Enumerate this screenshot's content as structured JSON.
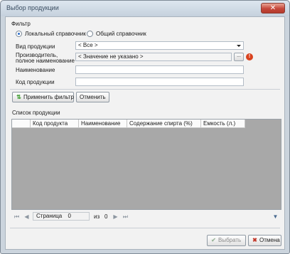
{
  "window": {
    "title": "Выбор продукции",
    "close_glyph": "✕"
  },
  "filter": {
    "group_title": "Фильтр",
    "radio_local": "Локальный справочник",
    "radio_common": "Общий справочник",
    "product_type_label": "Вид продукции",
    "product_type_value": "< Все >",
    "producer_label_line1": "Производитель,",
    "producer_label_line2": "полное наименование",
    "producer_value": "< Значение не указано >",
    "browse_label": "...",
    "info_glyph": "!",
    "name_label": "Наименование",
    "name_value": "",
    "code_label": "Код продукции",
    "code_value": "",
    "apply_button": "Применить фильтр",
    "reset_button": "Отменить"
  },
  "list": {
    "title": "Список продукции",
    "columns": [
      "Код продукта",
      "Наименование",
      "Содержание спирта (%)",
      "Емкость (л.)"
    ],
    "rows": []
  },
  "pager": {
    "page_label": "Страница",
    "page_value": "0",
    "of_label": "из",
    "total_value": "0"
  },
  "footer": {
    "select_button": "Выбрать",
    "cancel_button": "Отмена"
  },
  "colors": {
    "grid_background": "#a8a8a8",
    "accent_red": "#d9421e",
    "apply_icon": "#3a9a2a"
  }
}
